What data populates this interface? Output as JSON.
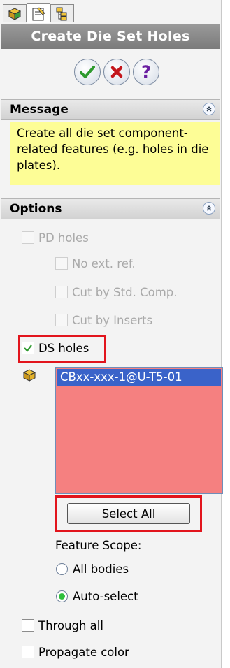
{
  "title": "Create Die Set Holes",
  "tabs": [
    {
      "icon": "feature-manager-icon"
    },
    {
      "icon": "property-manager-icon"
    },
    {
      "icon": "configuration-manager-icon"
    }
  ],
  "actions": [
    {
      "name": "ok",
      "icon": "checkmark-icon",
      "color": "#2e9a2e"
    },
    {
      "name": "cancel",
      "icon": "x-icon",
      "color": "#c4161c"
    },
    {
      "name": "help",
      "icon": "question-icon",
      "glyph": "?",
      "color": "#6a1fa1"
    }
  ],
  "message": {
    "header": "Message",
    "text": "Create all die set component-related features (e.g. holes in die plates)."
  },
  "options": {
    "header": "Options",
    "pd_holes": "PD holes",
    "no_ext_ref": "No ext. ref.",
    "cut_std_comp": "Cut by Std. Comp.",
    "cut_inserts": "Cut by Inserts",
    "ds_holes": "DS holes",
    "list_items": [
      "CBxx-xxx-1@U-T5-01"
    ],
    "select_all": "Select All",
    "feature_scope": "Feature Scope:",
    "all_bodies": "All bodies",
    "auto_select": "Auto-select",
    "through_all": "Through all",
    "propagate_color": "Propagate color"
  },
  "state": {
    "pd_holes_checked": false,
    "ds_holes_checked": true,
    "through_all_checked": false,
    "propagate_color_checked": false,
    "feature_scope": "Auto-select"
  },
  "colors": {
    "title_bg": "#8a8a8a",
    "message_bg": "#fdfd96",
    "list_bg": "#f58080",
    "list_selection": "#3a63c9",
    "highlight": "#e2141c"
  }
}
